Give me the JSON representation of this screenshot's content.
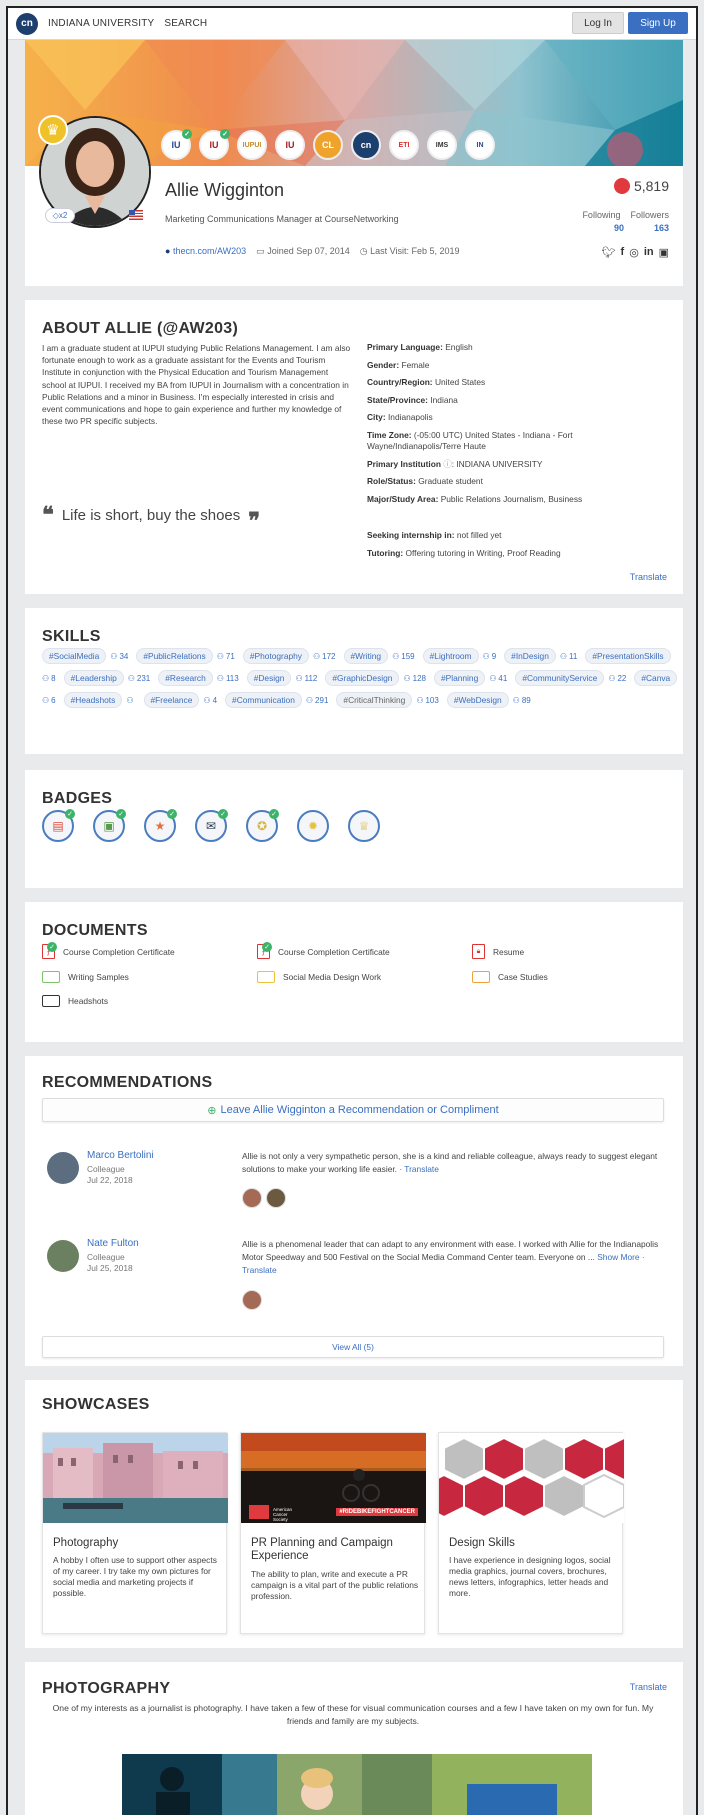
{
  "nav": {
    "logo": "cn",
    "institution": "INDIANA UNIVERSITY",
    "search": "SEARCH",
    "login": "Log In",
    "signup": "Sign Up"
  },
  "profile": {
    "name": "Allie Wigginton",
    "title": "Marketing Communications Manager at CourseNetworking",
    "badge_multiplier": "x2",
    "url": "thecn.com/AW203",
    "joined": "Joined Sep 07, 2014",
    "last_visit": "Last Visit: Feb 5, 2019",
    "score": "5,819",
    "following_label": "Following",
    "followers_label": "Followers",
    "following": "90",
    "followers": "163",
    "institutions": [
      "IU",
      "IU",
      "IUPUI",
      "IU",
      "CL",
      "cn",
      "ETI",
      "IMS",
      "IN"
    ]
  },
  "about": {
    "title": "ABOUT ALLIE (@AW203)",
    "bio": "I am a graduate student at IUPUI studying Public Relations Management. I am also fortunate enough to work as a graduate assistant for the Events and Tourism Institute in conjunction with the Physical Education and Tourism Management school at IUPUI. I received my BA from IUPUI in Journalism with a concentration in Public Relations and a minor in Business. I'm especially interested in crisis and event communications and hope to gain experience and further my knowledge of these two PR specific subjects.",
    "quote": "Life is short, buy the shoes",
    "facts": [
      {
        "label": "Primary Language:",
        "value": "English"
      },
      {
        "label": "Gender:",
        "value": "Female"
      },
      {
        "label": "Country/Region:",
        "value": "United States"
      },
      {
        "label": "State/Province:",
        "value": "Indiana"
      },
      {
        "label": "City:",
        "value": "Indianapolis"
      },
      {
        "label": "Time Zone:",
        "value": "(-05:00 UTC) United States - Indiana - Fort Wayne/Indianapolis/Terre Haute"
      },
      {
        "label": "Primary Institution",
        "value": "INDIANA UNIVERSITY"
      },
      {
        "label": "Role/Status:",
        "value": "Graduate student"
      },
      {
        "label": "Major/Study Area:",
        "value": "Public Relations Journalism, Business"
      }
    ],
    "seeking_label": "Seeking internship in:",
    "seeking_value": "not filled yet",
    "tutoring_label": "Tutoring:",
    "tutoring_value": "Offering tutoring in Writing, Proof Reading",
    "translate": "Translate"
  },
  "skills": {
    "title": "SKILLS",
    "items": [
      {
        "tag": "#SocialMedia",
        "count": "34"
      },
      {
        "tag": "#PublicRelations",
        "count": "71"
      },
      {
        "tag": "#Photography",
        "count": "172"
      },
      {
        "tag": "#Writing",
        "count": "159"
      },
      {
        "tag": "#Lightroom",
        "count": "9"
      },
      {
        "tag": "#InDesign",
        "count": "11"
      },
      {
        "tag": "#PresentationSkills",
        "count": "8"
      },
      {
        "tag": "#Leadership",
        "count": "231"
      },
      {
        "tag": "#Research",
        "count": "113"
      },
      {
        "tag": "#Design",
        "count": "112"
      },
      {
        "tag": "#GraphicDesign",
        "count": "128"
      },
      {
        "tag": "#Planning",
        "count": "41"
      },
      {
        "tag": "#CommunityService",
        "count": "22"
      },
      {
        "tag": "#Canva",
        "count": "6"
      },
      {
        "tag": "#Headshots",
        "count": ""
      },
      {
        "tag": "#Freelance",
        "count": "4"
      },
      {
        "tag": "#Communication",
        "count": "291"
      },
      {
        "tag": "#CriticalThinking",
        "count": "103"
      },
      {
        "tag": "#WebDesign",
        "count": "89"
      }
    ]
  },
  "badges": {
    "title": "BADGES",
    "items": [
      {
        "icon": "certificate-icon",
        "color": "#e0493c",
        "checked": true
      },
      {
        "icon": "wallet-icon",
        "color": "#5a9a4b",
        "checked": true
      },
      {
        "icon": "wallet-star-icon",
        "color": "#e0703c",
        "checked": true
      },
      {
        "icon": "ask-post-icon",
        "color": "#2b3c52",
        "checked": true
      },
      {
        "icon": "trophy-star-icon",
        "color": "#d9b43a",
        "checked": true
      },
      {
        "icon": "lightbulb-icon",
        "color": "#e6c43a",
        "checked": false
      },
      {
        "icon": "trophy-icon",
        "color": "#d9b43a",
        "checked": false
      }
    ]
  },
  "documents": {
    "title": "DOCUMENTS",
    "items": [
      {
        "name": "Course Completion Certificate",
        "icon": "pdf-icon",
        "checked": true,
        "color": "#d33"
      },
      {
        "name": "Course Completion Certificate",
        "icon": "pdf-icon",
        "checked": true,
        "color": "#d33"
      },
      {
        "name": "Resume",
        "icon": "pdf-lock-icon",
        "checked": false,
        "color": "#d33"
      },
      {
        "name": "Writing Samples",
        "icon": "folder-icon",
        "checked": false,
        "color": "#7cc46a"
      },
      {
        "name": "Social Media Design Work",
        "icon": "folder-icon",
        "checked": false,
        "color": "#f0c23a"
      },
      {
        "name": "Case Studies",
        "icon": "folder-icon",
        "checked": false,
        "color": "#f0a23a"
      },
      {
        "name": "Headshots",
        "icon": "folder-icon",
        "checked": false,
        "color": "#333"
      }
    ]
  },
  "recommendations": {
    "title": "RECOMMENDATIONS",
    "leave": "Leave Allie Wigginton a Recommendation or Compliment",
    "items": [
      {
        "name": "Marco Bertolini",
        "role": "Colleague",
        "date": "Jul 22, 2018",
        "text": "Allie is not only a very sympathetic person, she is a kind and reliable colleague, always ready to suggest elegant solutions to make your working life easier.",
        "translate": "· Translate"
      },
      {
        "name": "Nate Fulton",
        "role": "Colleague",
        "date": "Jul 25, 2018",
        "text": "Allie is a phenomenal leader that can adapt to any environment with ease. I worked with Allie for the Indianapolis Motor Speedway and 500 Festival on the Social Media Command Center team. Everyone on ...",
        "more": "Show More",
        "translate": "· Translate"
      }
    ],
    "view_all": "View All (5)"
  },
  "showcases": {
    "title": "SHOWCASES",
    "items": [
      {
        "title": "Photography",
        "desc": "A hobby I often use to support other aspects of my career. I try take my own pictures for social media and marketing projects if possible."
      },
      {
        "title": "PR Planning and Campaign Experience",
        "desc": "The ability to plan, write and execute a PR campaign is a vital part of the public relations profession.",
        "banner": "#RIDEBIKEFIGHTCANCER",
        "logo": "American Cancer Society"
      },
      {
        "title": "Design Skills",
        "desc": "I have experience in designing logos, social media graphics, journal covers, brochures, news letters, infographics, letter heads and more."
      }
    ]
  },
  "photography": {
    "title": "PHOTOGRAPHY",
    "translate": "Translate",
    "text": "One of my interests as a journalist is photography. I have taken a few of these for visual communication courses and a few I have taken on my own for fun. My friends and family are my subjects."
  }
}
